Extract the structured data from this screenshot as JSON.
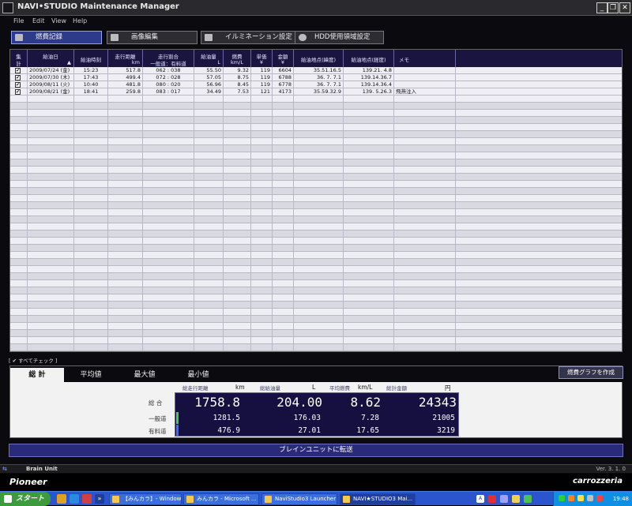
{
  "window": {
    "title": "NAVI•STUDIO  Maintenance Manager",
    "controls": {
      "minimize": "_",
      "restore": "❐",
      "close": "✕"
    }
  },
  "menu": [
    "File",
    "Edit",
    "View",
    "Help"
  ],
  "top_tabs": [
    {
      "label": "燃費記録",
      "active": true
    },
    {
      "label": "画像編集",
      "active": false
    },
    {
      "label": "イルミネーション設定",
      "active": false
    },
    {
      "label": "HDD使用領域設定",
      "active": false
    }
  ],
  "grid": {
    "columns": [
      {
        "top": "集",
        "bottom": "計",
        "unit": ""
      },
      {
        "top": "給油日",
        "bottom": "",
        "unit": "▲"
      },
      {
        "top": "給油時刻",
        "bottom": "",
        "unit": ""
      },
      {
        "top": "走行距離",
        "bottom": "",
        "unit": "km"
      },
      {
        "top": "走行割合",
        "bottom": "一般道：有料道",
        "unit": ""
      },
      {
        "top": "給油量",
        "bottom": "",
        "unit": "L"
      },
      {
        "top": "燃費",
        "bottom": "km/L",
        "unit": ""
      },
      {
        "top": "単価",
        "bottom": "¥",
        "unit": ""
      },
      {
        "top": "金額",
        "bottom": "¥",
        "unit": ""
      },
      {
        "top": "給油地点(緯度)",
        "bottom": "",
        "unit": ""
      },
      {
        "top": "給油地点(経度)",
        "bottom": "",
        "unit": ""
      },
      {
        "top": "メモ",
        "bottom": "",
        "unit": ""
      }
    ],
    "rows": [
      {
        "check": "✔",
        "date": "2009/07/24 (金)",
        "time": "15:23",
        "distance": "517.8",
        "ratio": "062 : 038",
        "fuel": "55.50",
        "mpg": "9.32",
        "unit_price": "119",
        "amount": "6604",
        "lat": "35.51.16.5",
        "lon": "139.21. 4.8",
        "memo": ""
      },
      {
        "check": "✔",
        "date": "2009/07/30 (木)",
        "time": "17:43",
        "distance": "499.4",
        "ratio": "072 : 028",
        "fuel": "57.05",
        "mpg": "8.75",
        "unit_price": "119",
        "amount": "6788",
        "lat": "36. 7. 7.1",
        "lon": "139.14.36.7",
        "memo": ""
      },
      {
        "check": "✔",
        "date": "2009/08/11 (火)",
        "time": "10:40",
        "distance": "481.8",
        "ratio": "080 : 020",
        "fuel": "56.96",
        "mpg": "8.45",
        "unit_price": "119",
        "amount": "6778",
        "lat": "36. 7. 7.1",
        "lon": "139.14.36.4",
        "memo": ""
      },
      {
        "check": "✔",
        "date": "2009/08/21 (金)",
        "time": "18:41",
        "distance": "259.8",
        "ratio": "083 : 017",
        "fuel": "34.49",
        "mpg": "7.53",
        "unit_price": "121",
        "amount": "4173",
        "lat": "35.59.32.9",
        "lon": "139. 5.26.3",
        "memo": "飛燕注入"
      }
    ]
  },
  "check_all": "[ ✔ すべてチェック ]",
  "summary": {
    "tabs": [
      "総 計",
      "平均値",
      "最大値",
      "最小値"
    ],
    "graph_button": "燃費グラフを作成",
    "headers": [
      "総走行距離",
      "総給油量",
      "平均燃費",
      "総計金額"
    ],
    "units": [
      "km",
      "L",
      "km/L",
      "円"
    ],
    "rows": [
      {
        "label": "総  合",
        "values": [
          "1758.8",
          "204.00",
          "8.62",
          "24343"
        ]
      },
      {
        "label": "一般道",
        "values": [
          "1281.5",
          "176.03",
          "7.28",
          "21005"
        ]
      },
      {
        "label": "有料道",
        "values": [
          "476.9",
          "27.01",
          "17.65",
          "3219"
        ]
      }
    ],
    "colors": {
      "general": "#3fcf4a",
      "toll": "#3a6bff"
    }
  },
  "transfer_button": "ブレインユニットに転送",
  "status": {
    "label": "Brain Unit",
    "version": "Ver. 3. 1. 0"
  },
  "brand": {
    "left": "Pioneer",
    "right": "carrozzeria"
  },
  "taskbar": {
    "start": "スタート",
    "buttons": [
      {
        "label": "【みんカラ】- Window..."
      },
      {
        "label": "みんカラ - Microsoft ..."
      },
      {
        "label": "NaviStudio3 Launcher"
      },
      {
        "label": "NAVI★STUDIO3 Mai..."
      }
    ],
    "clock": "19:48"
  }
}
